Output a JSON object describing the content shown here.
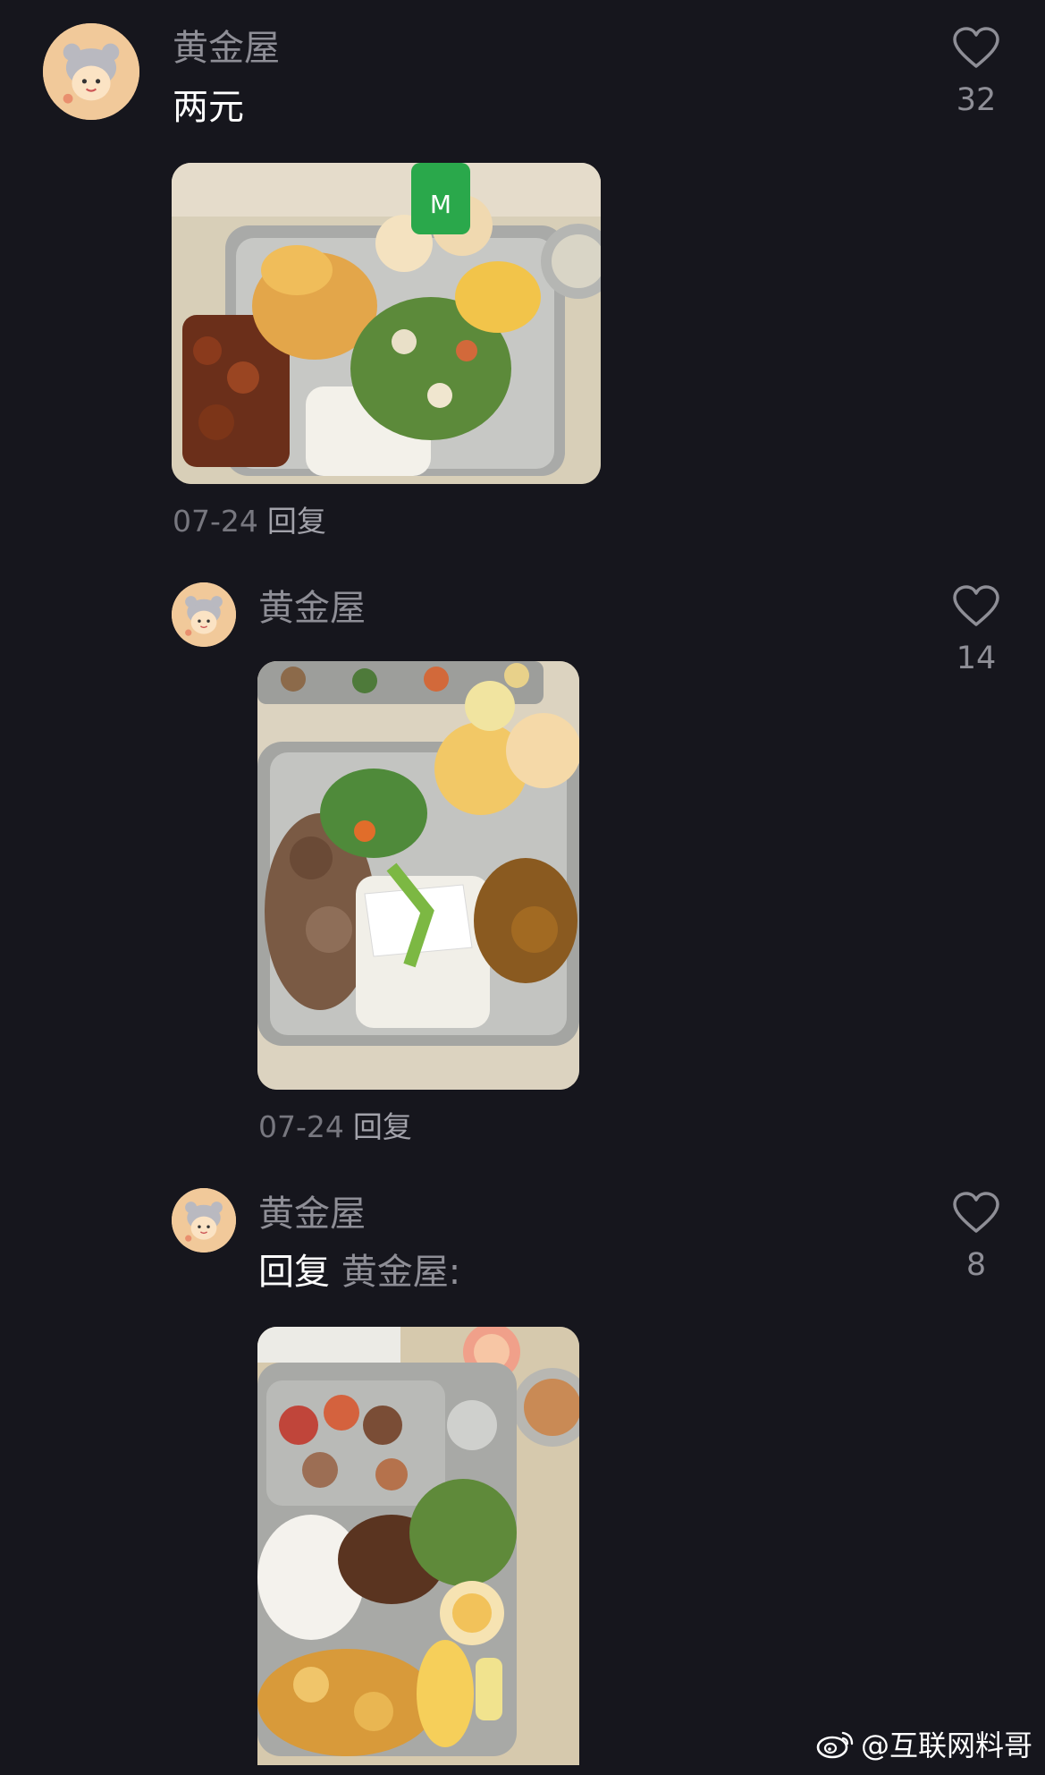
{
  "comments": [
    {
      "username": "黄金屋",
      "text": "两元",
      "date": "07-24",
      "reply_label": "回复",
      "likes": "32"
    },
    {
      "username": "黄金屋",
      "date": "07-24",
      "reply_label": "回复",
      "likes": "14"
    },
    {
      "username": "黄金屋",
      "reply_prefix": "回复",
      "reply_target": "黄金屋:",
      "likes": "8"
    }
  ],
  "watermark": {
    "text": "@互联网料哥",
    "icon": "weibo-icon"
  },
  "colors": {
    "background": "#16161d",
    "username": "#8e8e96",
    "text": "#ffffff"
  }
}
